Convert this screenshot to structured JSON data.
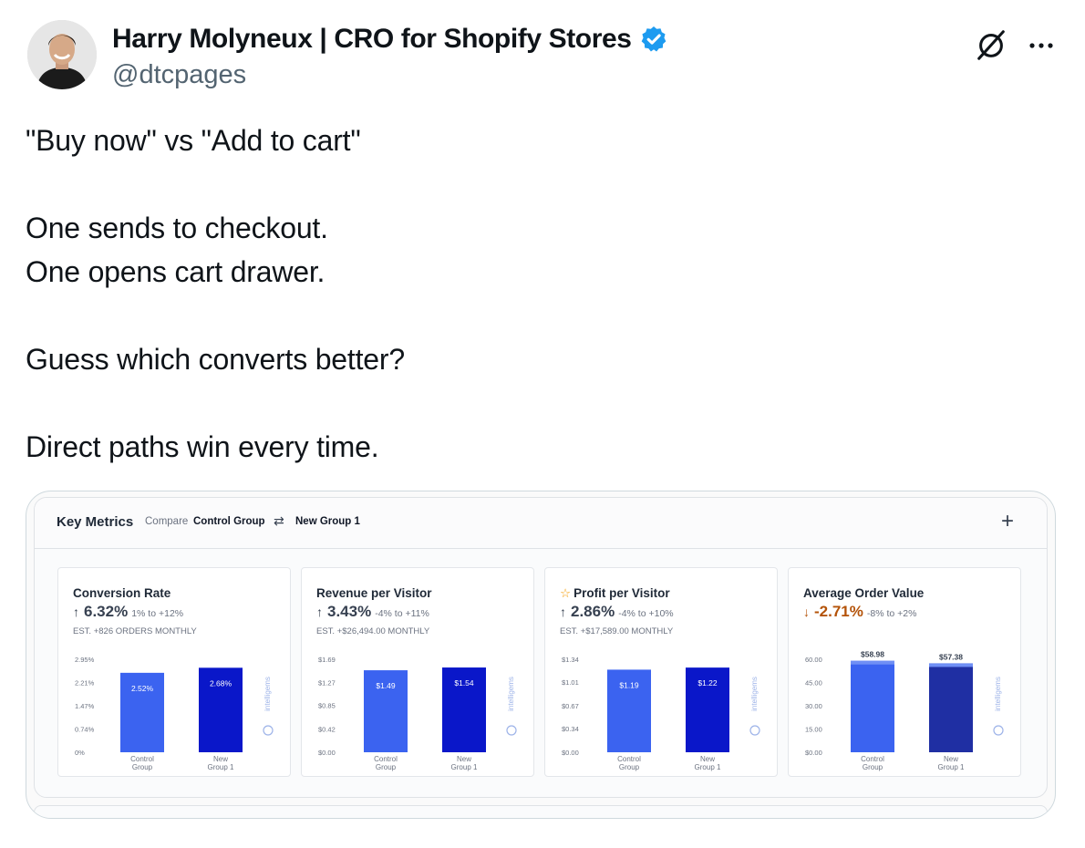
{
  "tweet": {
    "author_name": "Harry Molyneux | CRO for Shopify Stores",
    "handle": "@dtcpages",
    "lines": [
      "\"Buy now\" vs \"Add to cart\"",
      "",
      "One sends to checkout.",
      "One opens cart drawer.",
      "",
      "Guess which converts better?",
      "",
      "Direct paths win every time."
    ]
  },
  "dashboard": {
    "title": "Key Metrics",
    "compare_label": "Compare",
    "group_a": "Control Group",
    "swap_glyph": "⇄",
    "group_b": "New Group 1",
    "add_glyph": "+",
    "watermark": "intelligems"
  },
  "chart_data": [
    {
      "type": "bar",
      "title": "Conversion Rate",
      "direction": "up",
      "headline": "6.32%",
      "range": "1% to +12%",
      "estimate": "EST. +826 ORDERS MONTHLY",
      "categories": [
        [
          "Control",
          "Group"
        ],
        [
          "New",
          "Group 1"
        ]
      ],
      "values": [
        2.52,
        2.68
      ],
      "value_labels": [
        "2.52%",
        "2.68%"
      ],
      "label_position": "inside",
      "y_ticks": [
        2.95,
        2.21,
        1.47,
        0.74,
        0
      ],
      "y_tick_labels": [
        "2.95%",
        "2.21%",
        "1.47%",
        "0.74%",
        "0%"
      ],
      "ylim": [
        0,
        2.95
      ],
      "colors": [
        "#3b63f0",
        "#0a17c9"
      ]
    },
    {
      "type": "bar",
      "title": "Revenue per Visitor",
      "direction": "up",
      "headline": "3.43%",
      "range": "-4% to +11%",
      "estimate": "EST. +$26,494.00 MONTHLY",
      "categories": [
        [
          "Control",
          "Group"
        ],
        [
          "New",
          "Group 1"
        ]
      ],
      "values": [
        1.49,
        1.54
      ],
      "value_labels": [
        "$1.49",
        "$1.54"
      ],
      "label_position": "inside",
      "y_ticks": [
        1.69,
        1.27,
        0.85,
        0.42,
        0
      ],
      "y_tick_labels": [
        "$1.69",
        "$1.27",
        "$0.85",
        "$0.42",
        "$0.00"
      ],
      "ylim": [
        0,
        1.69
      ],
      "colors": [
        "#3b63f0",
        "#0a17c9"
      ]
    },
    {
      "type": "bar",
      "title": "Profit per Visitor",
      "starred": true,
      "direction": "up",
      "headline": "2.86%",
      "range": "-4% to +10%",
      "estimate": "EST. +$17,589.00 MONTHLY",
      "categories": [
        [
          "Control",
          "Group"
        ],
        [
          "New",
          "Group 1"
        ]
      ],
      "values": [
        1.19,
        1.22
      ],
      "value_labels": [
        "$1.19",
        "$1.22"
      ],
      "label_position": "inside",
      "y_ticks": [
        1.34,
        1.01,
        0.67,
        0.34,
        0
      ],
      "y_tick_labels": [
        "$1.34",
        "$1.01",
        "$0.67",
        "$0.34",
        "$0.00"
      ],
      "ylim": [
        0,
        1.34
      ],
      "colors": [
        "#3b63f0",
        "#0a17c9"
      ]
    },
    {
      "type": "bar",
      "title": "Average Order Value",
      "direction": "down",
      "headline": "-2.71%",
      "range": "-8% to +2%",
      "categories": [
        [
          "Control",
          "Group"
        ],
        [
          "New",
          "Group 1"
        ]
      ],
      "values": [
        58.98,
        57.38
      ],
      "value_labels": [
        "$58.98",
        "$57.38"
      ],
      "label_position": "above",
      "y_ticks": [
        60,
        45,
        30,
        15,
        0
      ],
      "y_tick_labels": [
        "60.00",
        "45.00",
        "30.00",
        "15.00",
        "$0.00"
      ],
      "ylim": [
        0,
        60
      ],
      "colors": [
        "#3b63f0",
        "#1f2fa3"
      ]
    }
  ]
}
